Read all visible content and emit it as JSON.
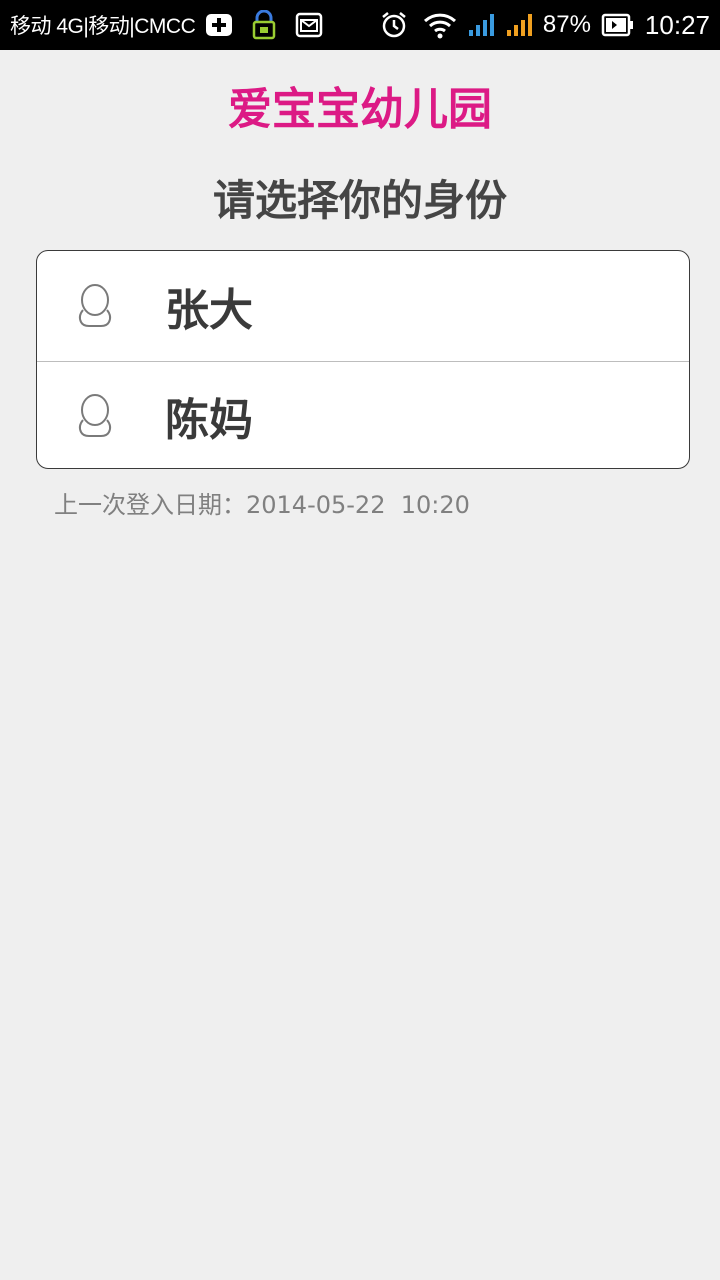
{
  "status_bar": {
    "carrier": "移动 4G|移动|CMCC",
    "battery": "87%",
    "time": "10:27",
    "icons": [
      "plus-icon",
      "lock-icon",
      "mail-icon",
      "alarm-icon",
      "wifi-icon",
      "signal-icon",
      "signal-icon",
      "battery-icon"
    ]
  },
  "header": {
    "app_title": "爱宝宝幼儿园",
    "subtitle": "请选择你的身份"
  },
  "identities": [
    {
      "name": "张大",
      "icon": "user-icon"
    },
    {
      "name": "陈妈",
      "icon": "user-icon"
    }
  ],
  "footer": {
    "last_login": "上一次登入日期：2014-05-22  10:20"
  },
  "colors": {
    "title": "#dc1a85",
    "background": "#efefef",
    "text": "#3a3a3a",
    "muted": "#808080"
  }
}
